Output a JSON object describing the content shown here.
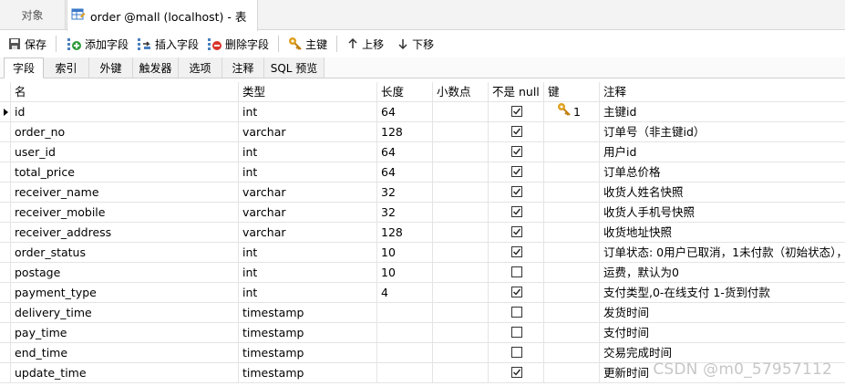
{
  "tabs": {
    "objects_label": "对象",
    "active_title": "order @mall (localhost) - 表"
  },
  "toolbar": {
    "save": "保存",
    "add_field": "添加字段",
    "insert_field": "插入字段",
    "delete_field": "删除字段",
    "primary_key": "主键",
    "move_up": "上移",
    "move_down": "下移"
  },
  "subtabs": [
    "字段",
    "索引",
    "外键",
    "触发器",
    "选项",
    "注释",
    "SQL 预览"
  ],
  "grid": {
    "headers": {
      "name": "名",
      "type": "类型",
      "length": "长度",
      "decimals": "小数点",
      "not_null": "不是 null",
      "key": "键",
      "comment": "注释"
    },
    "rows": [
      {
        "name": "id",
        "type": "int",
        "length": "64",
        "decimals": "",
        "not_null": true,
        "key": "1",
        "comment": "主键id"
      },
      {
        "name": "order_no",
        "type": "varchar",
        "length": "128",
        "decimals": "",
        "not_null": true,
        "key": "",
        "comment": "订单号（非主键id）"
      },
      {
        "name": "user_id",
        "type": "int",
        "length": "64",
        "decimals": "",
        "not_null": true,
        "key": "",
        "comment": "用户id"
      },
      {
        "name": "total_price",
        "type": "int",
        "length": "64",
        "decimals": "",
        "not_null": true,
        "key": "",
        "comment": "订单总价格"
      },
      {
        "name": "receiver_name",
        "type": "varchar",
        "length": "32",
        "decimals": "",
        "not_null": true,
        "key": "",
        "comment": "收货人姓名快照"
      },
      {
        "name": "receiver_mobile",
        "type": "varchar",
        "length": "32",
        "decimals": "",
        "not_null": true,
        "key": "",
        "comment": "收货人手机号快照"
      },
      {
        "name": "receiver_address",
        "type": "varchar",
        "length": "128",
        "decimals": "",
        "not_null": true,
        "key": "",
        "comment": "收货地址快照"
      },
      {
        "name": "order_status",
        "type": "int",
        "length": "10",
        "decimals": "",
        "not_null": true,
        "key": "",
        "comment": "订单状态: 0用户已取消，1未付款（初始状态），2"
      },
      {
        "name": "postage",
        "type": "int",
        "length": "10",
        "decimals": "",
        "not_null": false,
        "key": "",
        "comment": "运费，默认为0"
      },
      {
        "name": "payment_type",
        "type": "int",
        "length": "4",
        "decimals": "",
        "not_null": true,
        "key": "",
        "comment": "支付类型,0-在线支付 1-货到付款"
      },
      {
        "name": "delivery_time",
        "type": "timestamp",
        "length": "",
        "decimals": "",
        "not_null": false,
        "key": "",
        "comment": "发货时间"
      },
      {
        "name": "pay_time",
        "type": "timestamp",
        "length": "",
        "decimals": "",
        "not_null": false,
        "key": "",
        "comment": "支付时间"
      },
      {
        "name": "end_time",
        "type": "timestamp",
        "length": "",
        "decimals": "",
        "not_null": false,
        "key": "",
        "comment": "交易完成时间"
      },
      {
        "name": "update_time",
        "type": "timestamp",
        "length": "",
        "decimals": "",
        "not_null": true,
        "key": "",
        "comment": "更新时间"
      }
    ]
  },
  "watermark": "CSDN @m0_57957112",
  "colors": {
    "key_icon": "#e0a020",
    "add_icon": "#2e9c3c",
    "delete_icon": "#d9342b",
    "table_icon": "#3a78c8"
  }
}
